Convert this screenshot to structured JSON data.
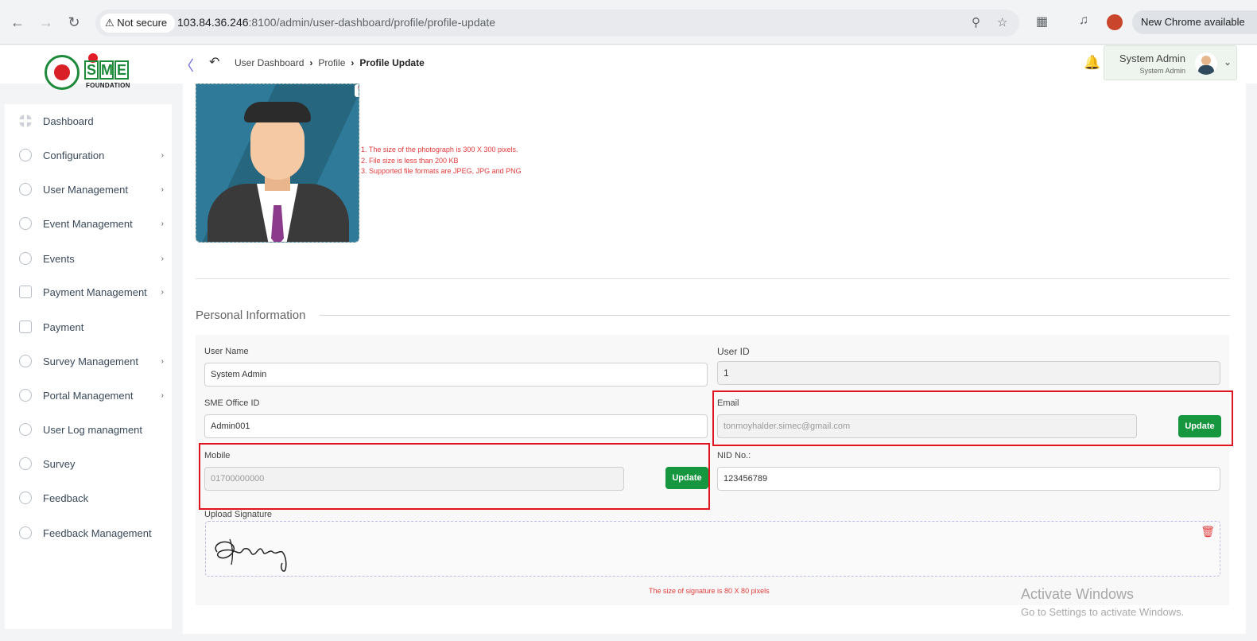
{
  "browser": {
    "security_label": "Not secure",
    "url_host": "103.84.36.246",
    "url_rest": ":8100/admin/user-dashboard/profile/profile-update",
    "new_chrome": "New Chrome available"
  },
  "header": {
    "logo_text": "FOUNDATION",
    "logo_letters": [
      "S",
      "M",
      "E"
    ],
    "breadcrumb": [
      "User Dashboard",
      "Profile",
      "Profile Update"
    ],
    "user_name": "System Admin",
    "user_role": "System Admin"
  },
  "sidebar": {
    "items": [
      {
        "label": "Dashboard",
        "icon": "grid-icon",
        "has_children": false
      },
      {
        "label": "Configuration",
        "icon": "config-icon",
        "has_children": true
      },
      {
        "label": "User Management",
        "icon": "shield-icon",
        "has_children": true
      },
      {
        "label": "Event Management",
        "icon": "lock-icon",
        "has_children": true
      },
      {
        "label": "Events",
        "icon": "lock-icon",
        "has_children": true
      },
      {
        "label": "Payment Management",
        "icon": "card-icon",
        "has_children": true
      },
      {
        "label": "Payment",
        "icon": "card-icon",
        "has_children": false
      },
      {
        "label": "Survey Management",
        "icon": "pie-icon",
        "has_children": true
      },
      {
        "label": "Portal Management",
        "icon": "lock-icon",
        "has_children": true
      },
      {
        "label": "User Log managment",
        "icon": "lock-icon",
        "has_children": false
      },
      {
        "label": "Survey",
        "icon": "pie-icon",
        "has_children": false
      },
      {
        "label": "Feedback",
        "icon": "feedback-icon",
        "has_children": false
      },
      {
        "label": "Feedback Management",
        "icon": "feedback-icon",
        "has_children": false
      }
    ]
  },
  "photo": {
    "rules": [
      "1. The size of the photograph is 300 X 300 pixels.",
      "2. File size is less than 200 KB",
      "3. Supported file formats are JPEG, JPG and PNG"
    ]
  },
  "form": {
    "section_title": "Personal Information",
    "user_name_label": "User Name",
    "user_name_value": "System Admin",
    "user_id_label": "User ID",
    "user_id_value": "1",
    "office_id_label": "SME Office ID",
    "office_id_value": "Admin001",
    "email_label": "Email",
    "email_placeholder": "tonmoyhalder.simec@gmail.com",
    "mobile_label": "Mobile",
    "mobile_placeholder": "01700000000",
    "nid_label": "NID No.:",
    "nid_value": "123456789",
    "update_label": "Update",
    "signature_label": "Upload Signature",
    "signature_note": "The size of signature is 80 X 80 pixels"
  },
  "watermark": {
    "line1": "Activate Windows",
    "line2": "Go to Settings to activate Windows."
  }
}
